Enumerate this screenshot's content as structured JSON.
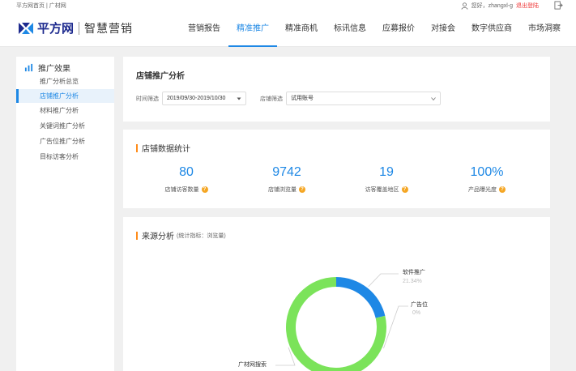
{
  "topbar": {
    "links": "平方网首页 | 广材网",
    "greeting": "您好，zhangxl-g",
    "logout": "退出登陆"
  },
  "brand": {
    "name": "平方网",
    "sub": "智慧营销",
    "color": "#1d2a8e"
  },
  "nav": [
    {
      "label": "营销报告"
    },
    {
      "label": "精准推广",
      "active": true
    },
    {
      "label": "精准商机"
    },
    {
      "label": "标讯信息"
    },
    {
      "label": "应募报价"
    },
    {
      "label": "对接会"
    },
    {
      "label": "数字供应商"
    },
    {
      "label": "市场洞察"
    }
  ],
  "sidebar": {
    "heading": "推广效果",
    "items": [
      {
        "label": "推广分析总览"
      },
      {
        "label": "店铺推广分析",
        "active": true
      },
      {
        "label": "材料推广分析"
      },
      {
        "label": "关键词推广分析"
      },
      {
        "label": "广告位推广分析"
      },
      {
        "label": "目标访客分析"
      }
    ]
  },
  "shop_analysis": {
    "title": "店铺推广分析",
    "date_label": "时间筛选",
    "date_value": "2019/09/30-2019/10/30",
    "shop_label": "店铺筛选",
    "shop_value": "试用账号"
  },
  "stats": {
    "title": "店铺数据统计",
    "items": [
      {
        "value": "80",
        "label": "店铺访客数量"
      },
      {
        "value": "9742",
        "label": "店铺浏览量"
      },
      {
        "value": "19",
        "label": "访客覆盖地区"
      },
      {
        "value": "100%",
        "label": "产品曝光度"
      }
    ]
  },
  "source": {
    "title": "来源分析",
    "note": "(统计指标：浏览量)",
    "help_glyph": "?"
  },
  "chart_data": {
    "type": "pie",
    "categories": [
      "软件推广",
      "广告位",
      "广材网搜索"
    ],
    "values": [
      21.34,
      0,
      78.66
    ],
    "labels": [
      "软件推广",
      "广告位",
      "广材网搜索"
    ],
    "percent_labels": [
      "21.34%",
      "0%",
      ""
    ],
    "colors": [
      "#1e88e5",
      "#f5a623",
      "#7be35a"
    ],
    "donut": true
  },
  "colors": {
    "accent": "#1e88e5",
    "highlight": "#ff8c1a",
    "background": "#f0f0f0"
  }
}
